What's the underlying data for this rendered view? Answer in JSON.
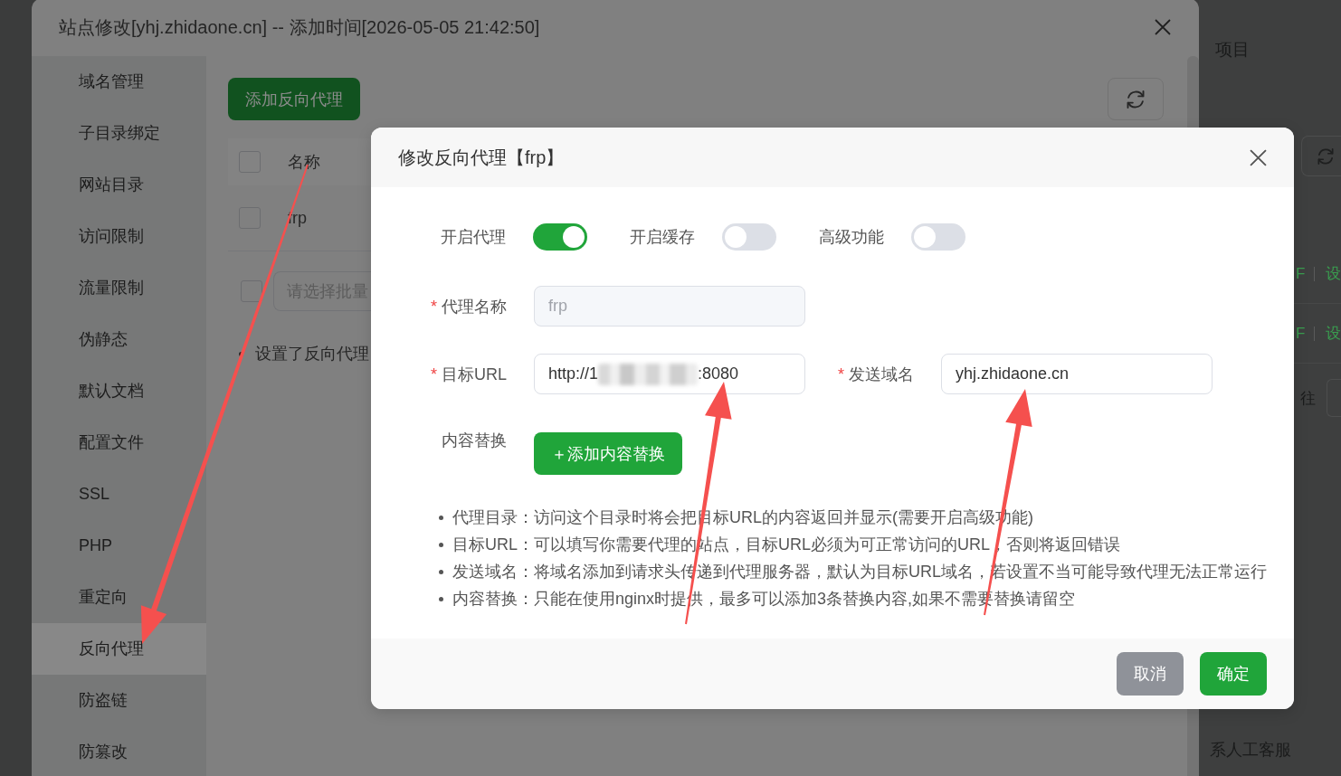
{
  "background_page": {
    "heading_fragment": "项目",
    "rows": [
      {
        "cells": [
          "F",
          "设"
        ]
      },
      {
        "cells": [
          "F",
          "设"
        ]
      }
    ],
    "pager_fragment": "往",
    "help_link_fragment": "系人工客服"
  },
  "site_dialog": {
    "title": "站点修改[yhj.zhidaone.cn] -- 添加时间[2026-05-05 21:42:50]",
    "sidebar": {
      "items": [
        {
          "label": "域名管理",
          "selected": false
        },
        {
          "label": "子目录绑定",
          "selected": false
        },
        {
          "label": "网站目录",
          "selected": false
        },
        {
          "label": "访问限制",
          "selected": false
        },
        {
          "label": "流量限制",
          "selected": false
        },
        {
          "label": "伪静态",
          "selected": false
        },
        {
          "label": "默认文档",
          "selected": false
        },
        {
          "label": "配置文件",
          "selected": false
        },
        {
          "label": "SSL",
          "selected": false
        },
        {
          "label": "PHP",
          "selected": false
        },
        {
          "label": "重定向",
          "selected": false
        },
        {
          "label": "反向代理",
          "selected": true
        },
        {
          "label": "防盗链",
          "selected": false
        },
        {
          "label": "防篡改",
          "selected": false
        }
      ]
    },
    "add_button": "添加反向代理",
    "table": {
      "header_checked": false,
      "columns": [
        "名称"
      ],
      "rows": [
        {
          "checked": false,
          "cells": [
            "frp"
          ]
        }
      ]
    },
    "batch": {
      "checked": false,
      "placeholder": "请选择批量"
    },
    "notes": [
      "设置了反向代理"
    ]
  },
  "proxy_dialog": {
    "title": "修改反向代理【frp】",
    "switches": [
      {
        "label": "开启代理",
        "on": true
      },
      {
        "label": "开启缓存",
        "on": false
      },
      {
        "label": "高级功能",
        "on": false
      }
    ],
    "field_rows": [
      {
        "fields": [
          {
            "marker": "*",
            "label": "代理名称",
            "value": "frp",
            "disabled": true
          }
        ]
      },
      {
        "fields": [
          {
            "marker": "*",
            "label": "目标URL",
            "value": "http://1",
            "redacted": true,
            "value_suffix": ":8080",
            "disabled": false
          },
          {
            "marker": "*",
            "label": "发送域名",
            "value": "yhj.zhidaone.cn",
            "disabled": false
          }
        ]
      }
    ],
    "content_replace": {
      "label": "内容替换",
      "button": "＋添加内容替换"
    },
    "notes": [
      "代理目录：访问这个目录时将会把目标URL的内容返回并显示(需要开启高级功能)",
      "目标URL：可以填写你需要代理的站点，目标URL必须为可正常访问的URL，否则将返回错误",
      "发送域名：将域名添加到请求头传递到代理服务器，默认为目标URL域名，若设置不当可能导致代理无法正常运行",
      "内容替换：只能在使用nginx时提供，最多可以添加3条替换内容,如果不需要替换请留空"
    ],
    "buttons": [
      {
        "label": "取消",
        "kind": "secondary"
      },
      {
        "label": "确定",
        "kind": "primary"
      }
    ]
  },
  "annotations": [
    {
      "kind": "arrow"
    },
    {
      "kind": "arrow"
    },
    {
      "kind": "arrow"
    }
  ]
}
